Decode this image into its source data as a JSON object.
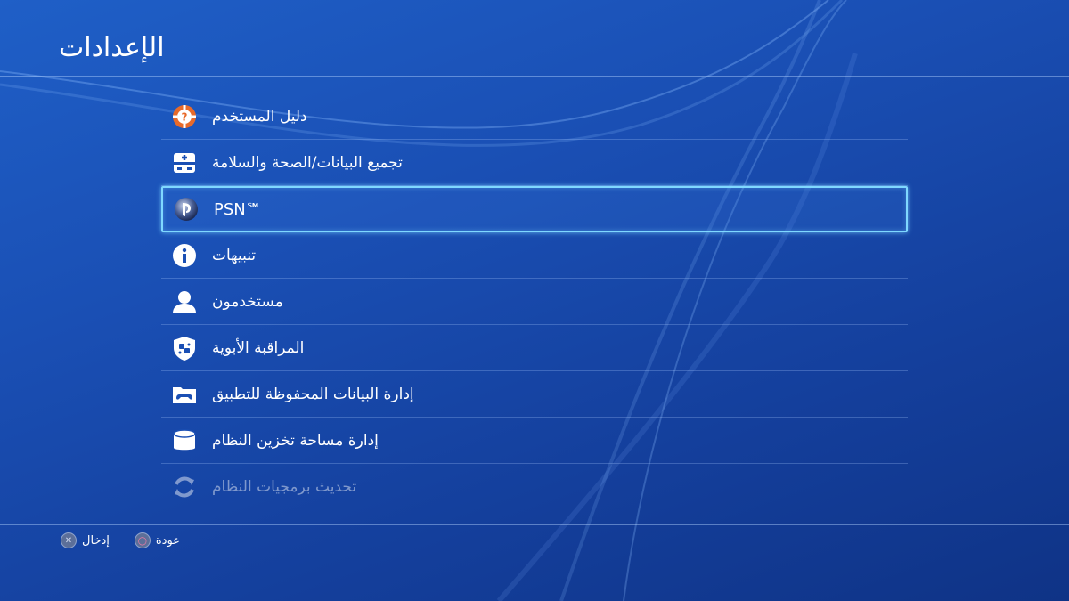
{
  "screen": {
    "title": "الإعدادات"
  },
  "menu": {
    "items": [
      {
        "label": "دليل المستخدم",
        "icon": "help-lifebuoy-icon"
      },
      {
        "label": "تجميع البيانات/الصحة والسلامة",
        "icon": "health-safety-icon"
      },
      {
        "label": "PSN℠",
        "icon": "psn-icon",
        "selected": true
      },
      {
        "label": "تنبيهات",
        "icon": "info-icon"
      },
      {
        "label": "مستخدمون",
        "icon": "user-icon"
      },
      {
        "label": "المراقبة الأبوية",
        "icon": "parental-controls-icon"
      },
      {
        "label": "إدارة البيانات المحفوظة للتطبيق",
        "icon": "saved-data-folder-icon"
      },
      {
        "label": "إدارة مساحة تخزين النظام",
        "icon": "storage-cylinder-icon"
      },
      {
        "label": "تحديث برمجيات النظام",
        "icon": "system-update-icon"
      }
    ]
  },
  "footer": {
    "enter_label": "إدخال",
    "enter_button_icon": "cross-button-icon",
    "back_label": "عودة",
    "back_button_icon": "circle-button-icon"
  },
  "colors": {
    "background": "#1a4fb4",
    "selection_border": "#7fd8ff",
    "icon_orange": "#e86a2a"
  }
}
